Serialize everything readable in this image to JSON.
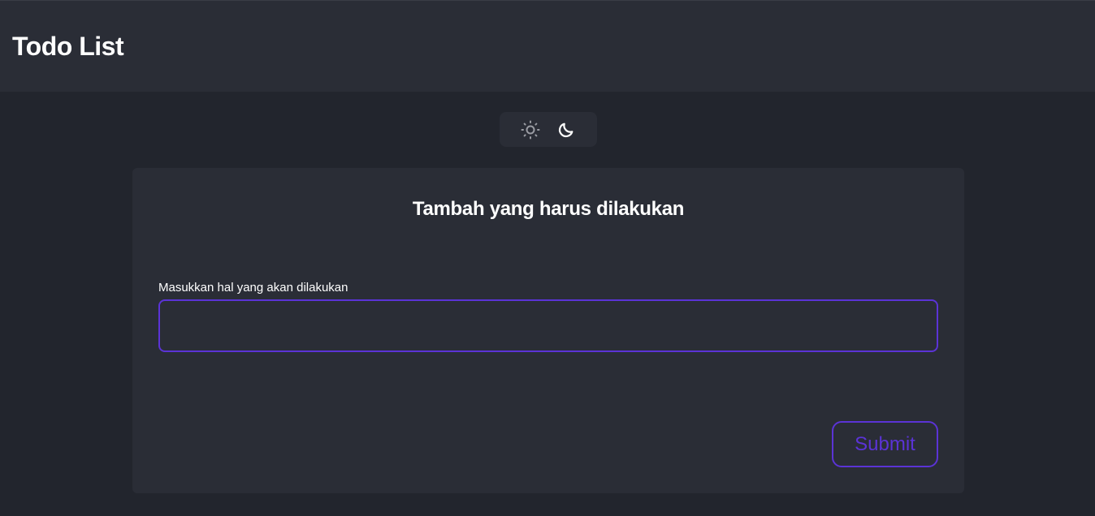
{
  "header": {
    "title": "Todo List"
  },
  "theme_toggle": {
    "light_icon": "sun-icon",
    "dark_icon": "moon-icon",
    "active": "dark"
  },
  "form": {
    "title": "Tambah yang harus dilakukan",
    "label": "Masukkan hal yang akan dilakukan",
    "value": "",
    "submit_label": "Submit"
  },
  "colors": {
    "background": "#22252d",
    "surface": "#2a2d36",
    "accent": "#5b33d6",
    "text": "#ffffff",
    "icon_inactive": "#9a9ca3"
  }
}
